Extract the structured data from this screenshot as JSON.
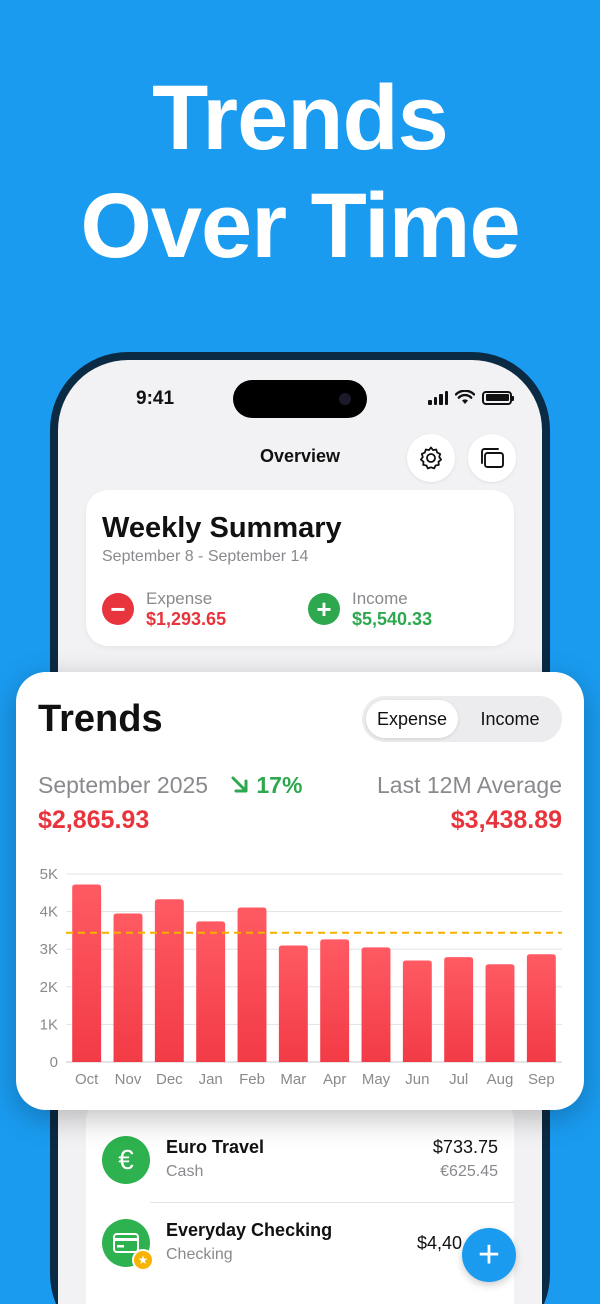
{
  "headline": {
    "line1": "Trends",
    "line2": "Over Time"
  },
  "status_bar": {
    "time": "9:41"
  },
  "nav": {
    "title": "Overview",
    "settings_icon": "gear-icon",
    "windows_icon": "windows-icon"
  },
  "summary": {
    "title": "Weekly Summary",
    "date_range": "September 8 - September 14",
    "expense": {
      "label": "Expense",
      "value": "$1,293.65",
      "icon": "minus-icon"
    },
    "income": {
      "label": "Income",
      "value": "$5,540.33",
      "icon": "plus-icon"
    }
  },
  "trends": {
    "title": "Trends",
    "tabs": [
      "Expense",
      "Income"
    ],
    "selected_tab": "Expense",
    "period": "September 2025",
    "change_icon": "arrow-down-right-icon",
    "change": "17%",
    "current_value": "$2,865.93",
    "average_label": "Last 12M Average",
    "average_value": "$3,438.89"
  },
  "chart_data": {
    "type": "bar",
    "categories": [
      "Oct",
      "Nov",
      "Dec",
      "Jan",
      "Feb",
      "Mar",
      "Apr",
      "May",
      "Jun",
      "Jul",
      "Aug",
      "Sep"
    ],
    "values": [
      4720,
      3950,
      4330,
      3740,
      4110,
      3100,
      3260,
      3050,
      2700,
      2790,
      2600,
      2866
    ],
    "average": 3438.89,
    "ylim": [
      0,
      5000
    ],
    "yticks": [
      0,
      1000,
      2000,
      3000,
      4000,
      5000
    ],
    "ytick_labels": [
      "0",
      "1K",
      "2K",
      "3K",
      "4K",
      "5K"
    ],
    "grid": true,
    "bar_color": "#f23b46",
    "average_line_color": "#f5b000"
  },
  "accounts": [
    {
      "name": "Euro Travel",
      "type": "Cash",
      "amount": "$733.75",
      "sub_amount": "€625.45",
      "icon": "euro-icon"
    },
    {
      "name": "Everyday Checking",
      "type": "Checking",
      "amount": "$4,40",
      "icon": "card-icon",
      "badge_icon": "star-icon"
    }
  ],
  "fab": {
    "icon": "plus-icon"
  },
  "colors": {
    "background": "#1a9bf0",
    "expense": "#e8343c",
    "income": "#2ea84f"
  }
}
